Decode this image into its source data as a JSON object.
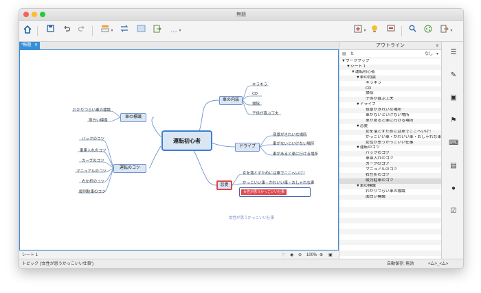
{
  "window": {
    "title": "無題"
  },
  "toolbar": {
    "icons": [
      "home-icon",
      "save-icon",
      "undo-icon",
      "redo-icon",
      "theme-icon",
      "dropdown-chevron",
      "swap-icon",
      "image-icon",
      "export-icon",
      "more-icon",
      "insert-icon",
      "idea-icon",
      "presentation-icon",
      "search-icon",
      "share-icon",
      "exit-icon"
    ],
    "more_label": "…",
    "dropdown_glyph": "▾"
  },
  "tab": {
    "label": "*無題",
    "close": "✕"
  },
  "mindmap": {
    "central": "運転初心者",
    "topics": {
      "car_interior": {
        "label": "車の内装",
        "items": [
          "キラキラ",
          "CD",
          "掃除",
          "子供が喜ぶ工夫"
        ]
      },
      "drive": {
        "label": "ドライブ",
        "items": [
          "夜景がきれいな場所",
          "車がないといけない場所",
          "車があると楽に行ける場所"
        ]
      },
      "romance": {
        "label": "恋愛",
        "items": [
          "女を落とすためには車でここへいけ！",
          "かっこいい車・かわいい車・おしゃれな車"
        ],
        "selected_item": "女性が思うかっこいい仕事"
      },
      "car_signs": {
        "label": "車の標識",
        "items": [
          "わかりづらい車の標識",
          "面白い標識"
        ]
      },
      "driving_tips": {
        "label": "運転のコツ",
        "items": [
          "バックのコツ",
          "車庫入れのコツ",
          "カーブのコツ",
          "マニュアルのコツ",
          "右左折のコツ",
          "縦列駐車のコツ"
        ]
      },
      "floating": "女性が思うかっこいい仕事"
    }
  },
  "statusbar": {
    "sheet": "シート 1",
    "zoom": "100%"
  },
  "bottombar": {
    "topic": "トピック ('女性が思うかっこいい仕事')",
    "autosave": "自動保存: 無効",
    "user": "<ム>_<ム>"
  },
  "outline": {
    "title": "アウトライン",
    "none_label": "なし",
    "rows": [
      {
        "text": "▼ワークブック",
        "indent": 0
      },
      {
        "text": "▼シート 1",
        "indent": 1
      },
      {
        "text": "▼運転初心者",
        "indent": 2
      },
      {
        "text": "▼車の内装",
        "indent": 3
      },
      {
        "text": "キラキラ",
        "indent": 5
      },
      {
        "text": "CD",
        "indent": 5
      },
      {
        "text": "掃除",
        "indent": 5
      },
      {
        "text": "子供が喜ぶ工夫",
        "indent": 5
      },
      {
        "text": "▼ドライブ",
        "indent": 3
      },
      {
        "text": "夜景がきれいな場所",
        "indent": 5
      },
      {
        "text": "車がないといけない場所",
        "indent": 5
      },
      {
        "text": "車があると楽に行ける場所",
        "indent": 5
      },
      {
        "text": "▼恋愛",
        "indent": 3
      },
      {
        "text": "女を落とすためには車でここへいけ！",
        "indent": 5
      },
      {
        "text": "かっこいい車・かわいい車・おしゃれな車",
        "indent": 5
      },
      {
        "text": "女性が思うかっこいい仕事",
        "indent": 5
      },
      {
        "text": "▼運転のコツ",
        "indent": 3
      },
      {
        "text": "バックのコツ",
        "indent": 5
      },
      {
        "text": "車庫入れのコツ",
        "indent": 5
      },
      {
        "text": "カーブのコツ",
        "indent": 5
      },
      {
        "text": "マニュアルのコツ",
        "indent": 5
      },
      {
        "text": "右左折のコツ",
        "indent": 5
      },
      {
        "text": "縦列駐車のコツ",
        "indent": 5,
        "selected": true
      },
      {
        "text": "▼車の標識",
        "indent": 3
      },
      {
        "text": "わかりづらい車の標識",
        "indent": 5
      },
      {
        "text": "面白い標識",
        "indent": 5
      }
    ]
  },
  "rail": {
    "icons": [
      "outline-icon",
      "format-brush-icon",
      "image-icon",
      "marker-flag-icon",
      "keyboard-icon",
      "notes-icon",
      "comment-icon",
      "task-icon"
    ]
  },
  "colors": {
    "accent": "#3a8fd9",
    "node_fill": "#dbe6f5",
    "node_border": "#6f94c7",
    "selected_red": "#e0474c"
  }
}
